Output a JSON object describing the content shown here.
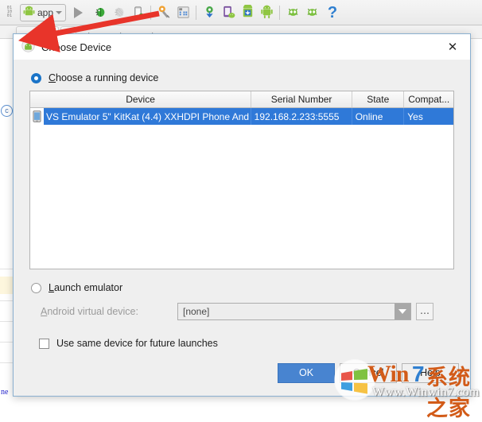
{
  "toolbar": {
    "binary_lines": [
      "01",
      "10",
      "01"
    ],
    "module_label": "app",
    "icons": [
      {
        "name": "binary-icon",
        "title": "Build variants"
      },
      {
        "name": "android-module-icon",
        "title": "app module"
      },
      {
        "name": "run-icon",
        "title": "Run"
      },
      {
        "name": "debug-bug-icon",
        "title": "Debug"
      },
      {
        "name": "coverage-icon",
        "title": "Run with coverage"
      },
      {
        "name": "attach-debugger-icon",
        "title": "Attach debugger to process"
      },
      {
        "name": "sdk-manager-wrench-icon",
        "title": "SDK Manager"
      },
      {
        "name": "layout-inspector-icon",
        "title": "Layout Inspector"
      },
      {
        "name": "sync-gradle-icon",
        "title": "Sync project with Gradle files"
      },
      {
        "name": "avd-manager-icon",
        "title": "AVD Manager"
      },
      {
        "name": "sdk-download-icon",
        "title": "SDK download"
      },
      {
        "name": "android-device-monitor-icon",
        "title": "Android Device Monitor"
      },
      {
        "name": "virtual-device-alien-icon",
        "title": "Virtual device"
      },
      {
        "name": "virtual-device-alien2-icon",
        "title": "Virtual device"
      },
      {
        "name": "help-icon",
        "title": "Help"
      }
    ]
  },
  "background": {
    "blue_text": "ne"
  },
  "dialog": {
    "title": "Choose Device",
    "app_icon_name": "android-head-icon",
    "close_label": "✕",
    "running_device": {
      "radio_label_prefix": "C",
      "radio_label": "Choose a running device",
      "selected": true
    },
    "table": {
      "columns": [
        "Device",
        "Serial Number",
        "State",
        "Compat..."
      ],
      "rows": [
        {
          "device": "VS Emulator 5\" KitKat (4.4) XXHDPI Phone And",
          "serial": "192.168.2.233:5555",
          "state": "Online",
          "compatible": "Yes",
          "selected": true,
          "icon_name": "phone-device-icon"
        }
      ]
    },
    "launch_emulator": {
      "radio_label": "Launch emulator",
      "selected": false,
      "avd_label": "Android virtual device:",
      "avd_value": "[none]",
      "avd_options": [
        "[none]"
      ],
      "ellipsis_label": "⋯"
    },
    "use_same_device": {
      "label": "Use same device for future launches",
      "checked": false
    },
    "buttons": {
      "ok": "OK",
      "cancel": "Cancel",
      "help": "Help"
    }
  },
  "watermark": {
    "win": "Win",
    "seven": "7",
    "cn": "系统之家",
    "url": "Www.Winwin7.com"
  },
  "annotation": {
    "arrow_color": "#e8342a",
    "arrow_name": "red-pointer-arrow"
  }
}
